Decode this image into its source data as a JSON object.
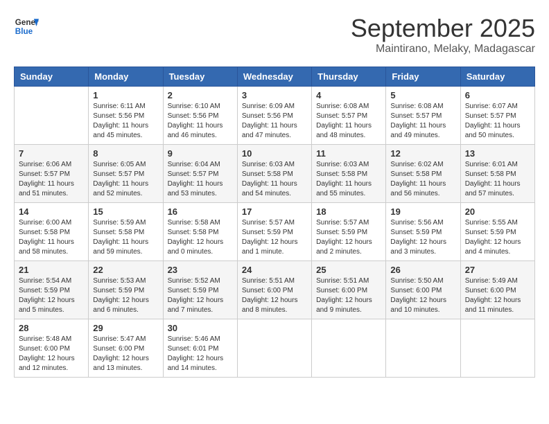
{
  "logo": {
    "line1": "General",
    "line2": "Blue"
  },
  "title": "September 2025",
  "location": "Maintirano, Melaky, Madagascar",
  "days_header": [
    "Sunday",
    "Monday",
    "Tuesday",
    "Wednesday",
    "Thursday",
    "Friday",
    "Saturday"
  ],
  "weeks": [
    [
      {
        "day": "",
        "info": ""
      },
      {
        "day": "1",
        "info": "Sunrise: 6:11 AM\nSunset: 5:56 PM\nDaylight: 11 hours\nand 45 minutes."
      },
      {
        "day": "2",
        "info": "Sunrise: 6:10 AM\nSunset: 5:56 PM\nDaylight: 11 hours\nand 46 minutes."
      },
      {
        "day": "3",
        "info": "Sunrise: 6:09 AM\nSunset: 5:56 PM\nDaylight: 11 hours\nand 47 minutes."
      },
      {
        "day": "4",
        "info": "Sunrise: 6:08 AM\nSunset: 5:57 PM\nDaylight: 11 hours\nand 48 minutes."
      },
      {
        "day": "5",
        "info": "Sunrise: 6:08 AM\nSunset: 5:57 PM\nDaylight: 11 hours\nand 49 minutes."
      },
      {
        "day": "6",
        "info": "Sunrise: 6:07 AM\nSunset: 5:57 PM\nDaylight: 11 hours\nand 50 minutes."
      }
    ],
    [
      {
        "day": "7",
        "info": "Sunrise: 6:06 AM\nSunset: 5:57 PM\nDaylight: 11 hours\nand 51 minutes."
      },
      {
        "day": "8",
        "info": "Sunrise: 6:05 AM\nSunset: 5:57 PM\nDaylight: 11 hours\nand 52 minutes."
      },
      {
        "day": "9",
        "info": "Sunrise: 6:04 AM\nSunset: 5:57 PM\nDaylight: 11 hours\nand 53 minutes."
      },
      {
        "day": "10",
        "info": "Sunrise: 6:03 AM\nSunset: 5:58 PM\nDaylight: 11 hours\nand 54 minutes."
      },
      {
        "day": "11",
        "info": "Sunrise: 6:03 AM\nSunset: 5:58 PM\nDaylight: 11 hours\nand 55 minutes."
      },
      {
        "day": "12",
        "info": "Sunrise: 6:02 AM\nSunset: 5:58 PM\nDaylight: 11 hours\nand 56 minutes."
      },
      {
        "day": "13",
        "info": "Sunrise: 6:01 AM\nSunset: 5:58 PM\nDaylight: 11 hours\nand 57 minutes."
      }
    ],
    [
      {
        "day": "14",
        "info": "Sunrise: 6:00 AM\nSunset: 5:58 PM\nDaylight: 11 hours\nand 58 minutes."
      },
      {
        "day": "15",
        "info": "Sunrise: 5:59 AM\nSunset: 5:58 PM\nDaylight: 11 hours\nand 59 minutes."
      },
      {
        "day": "16",
        "info": "Sunrise: 5:58 AM\nSunset: 5:58 PM\nDaylight: 12 hours\nand 0 minutes."
      },
      {
        "day": "17",
        "info": "Sunrise: 5:57 AM\nSunset: 5:59 PM\nDaylight: 12 hours\nand 1 minute."
      },
      {
        "day": "18",
        "info": "Sunrise: 5:57 AM\nSunset: 5:59 PM\nDaylight: 12 hours\nand 2 minutes."
      },
      {
        "day": "19",
        "info": "Sunrise: 5:56 AM\nSunset: 5:59 PM\nDaylight: 12 hours\nand 3 minutes."
      },
      {
        "day": "20",
        "info": "Sunrise: 5:55 AM\nSunset: 5:59 PM\nDaylight: 12 hours\nand 4 minutes."
      }
    ],
    [
      {
        "day": "21",
        "info": "Sunrise: 5:54 AM\nSunset: 5:59 PM\nDaylight: 12 hours\nand 5 minutes."
      },
      {
        "day": "22",
        "info": "Sunrise: 5:53 AM\nSunset: 5:59 PM\nDaylight: 12 hours\nand 6 minutes."
      },
      {
        "day": "23",
        "info": "Sunrise: 5:52 AM\nSunset: 5:59 PM\nDaylight: 12 hours\nand 7 minutes."
      },
      {
        "day": "24",
        "info": "Sunrise: 5:51 AM\nSunset: 6:00 PM\nDaylight: 12 hours\nand 8 minutes."
      },
      {
        "day": "25",
        "info": "Sunrise: 5:51 AM\nSunset: 6:00 PM\nDaylight: 12 hours\nand 9 minutes."
      },
      {
        "day": "26",
        "info": "Sunrise: 5:50 AM\nSunset: 6:00 PM\nDaylight: 12 hours\nand 10 minutes."
      },
      {
        "day": "27",
        "info": "Sunrise: 5:49 AM\nSunset: 6:00 PM\nDaylight: 12 hours\nand 11 minutes."
      }
    ],
    [
      {
        "day": "28",
        "info": "Sunrise: 5:48 AM\nSunset: 6:00 PM\nDaylight: 12 hours\nand 12 minutes."
      },
      {
        "day": "29",
        "info": "Sunrise: 5:47 AM\nSunset: 6:00 PM\nDaylight: 12 hours\nand 13 minutes."
      },
      {
        "day": "30",
        "info": "Sunrise: 5:46 AM\nSunset: 6:01 PM\nDaylight: 12 hours\nand 14 minutes."
      },
      {
        "day": "",
        "info": ""
      },
      {
        "day": "",
        "info": ""
      },
      {
        "day": "",
        "info": ""
      },
      {
        "day": "",
        "info": ""
      }
    ]
  ]
}
